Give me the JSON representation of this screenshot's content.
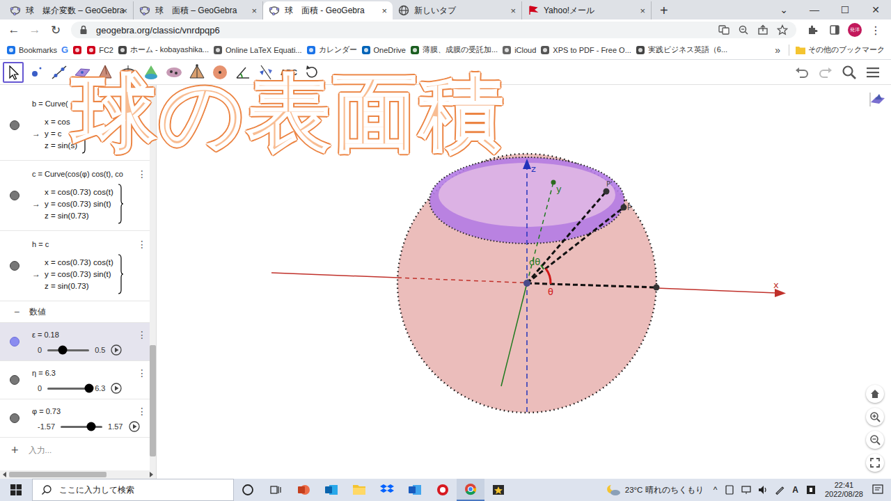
{
  "browser": {
    "tabs": [
      {
        "label": "球　媒介変数 – GeoGebra",
        "favicon": "geogebra",
        "selected": false
      },
      {
        "label": "球　面積 – GeoGebra",
        "favicon": "geogebra",
        "selected": false
      },
      {
        "label": "球　面積 - GeoGebra",
        "favicon": "geogebra",
        "selected": true
      },
      {
        "label": "新しいタブ",
        "favicon": "chrome",
        "selected": false
      },
      {
        "label": "Yahoo!メール",
        "favicon": "yahoo",
        "selected": false
      }
    ],
    "tab_close": "×",
    "new_tab": "+",
    "window_controls": [
      "⌄",
      "—",
      "☐",
      "✕"
    ],
    "nav": [
      "←",
      "→",
      "↻"
    ],
    "url": "geogebra.org/classic/vnrdpqp6",
    "profile": "発洋",
    "menu": "⋮",
    "bookmarks": [
      {
        "label": "Bookmarks",
        "color": "#1a73e8"
      },
      {
        "label": "G",
        "color": "#4285f4"
      },
      {
        "label": "",
        "color": "#d0021b"
      },
      {
        "label": "FC2",
        "color": "#d0021b"
      },
      {
        "label": "ホーム - kobayashika...",
        "color": "#444444"
      },
      {
        "label": "Online LaTeX Equati...",
        "color": "#555555"
      },
      {
        "label": "カレンダー",
        "color": "#1a73e8"
      },
      {
        "label": "OneDrive",
        "color": "#0364b8"
      },
      {
        "label": "薄膜、成膜の受託加...",
        "color": "#1b5e20"
      },
      {
        "label": "iCloud",
        "color": "#666666"
      },
      {
        "label": "XPS to PDF - Free O...",
        "color": "#555555"
      },
      {
        "label": "実践ビジネス英語（6...",
        "color": "#444444"
      }
    ],
    "bookmarks_more": "»",
    "other_bookmarks": "その他のブックマーク"
  },
  "toolbar": {
    "tools": [
      {
        "kind": "move",
        "label": "",
        "selected": true
      },
      {
        "kind": "point",
        "label": "",
        "selected": false
      },
      {
        "kind": "line",
        "label": "",
        "selected": false
      },
      {
        "kind": "plane",
        "label": "",
        "selected": false
      },
      {
        "kind": "pyramid",
        "label": "",
        "selected": false
      },
      {
        "kind": "circle",
        "label": "",
        "selected": false
      },
      {
        "kind": "cone",
        "label": "",
        "selected": false
      },
      {
        "kind": "intersect",
        "label": "",
        "selected": false
      },
      {
        "kind": "tetra",
        "label": "",
        "selected": false
      },
      {
        "kind": "sphere",
        "label": "",
        "selected": false
      },
      {
        "kind": "angle",
        "label": "",
        "selected": false
      },
      {
        "kind": "reflect",
        "label": "",
        "selected": false
      },
      {
        "kind": "text",
        "label": "ABC",
        "selected": false
      },
      {
        "kind": "rotate",
        "label": "",
        "selected": false
      }
    ]
  },
  "overlay_title": "球の表面積",
  "algebra": {
    "arrow": "→",
    "row_menu": "⋮",
    "rows": [
      {
        "kind": "curve",
        "selected": false,
        "definition": "b = Curve(",
        "lines": [
          "x = cos",
          "y = c",
          "z = sin(s)"
        ]
      },
      {
        "kind": "curve",
        "selected": false,
        "definition": "c = Curve(cos(φ) cos(t), co",
        "lines": [
          "x = cos(0.73) cos(t)",
          "y = cos(0.73) sin(t)",
          "z = sin(0.73)"
        ]
      },
      {
        "kind": "curve",
        "selected": false,
        "definition": "h = c",
        "lines": [
          "x = cos(0.73) cos(t)",
          "y = cos(0.73) sin(t)",
          "z = sin(0.73)"
        ]
      }
    ],
    "section": {
      "toggle": "−",
      "label": "数値"
    },
    "sliders": [
      {
        "name": "ε = 0.18",
        "min": "0",
        "max": "0.5",
        "level": 0.36,
        "selected": true
      },
      {
        "name": "η = 6.3",
        "min": "0",
        "max": "6.3",
        "level": 1,
        "selected": false
      },
      {
        "name": "φ = 0.73",
        "min": "-1.57",
        "max": "1.57",
        "level": 0.73,
        "selected": false
      }
    ],
    "input": {
      "plus": "+",
      "placeholder": "入力..."
    }
  },
  "graphics": {
    "labels": {
      "z": "z",
      "y": "y",
      "x": "x",
      "theta": "θ",
      "dtheta": "dθ",
      "p": "P",
      "p_prime": "P'"
    }
  },
  "taskbar": {
    "search": "ここに入力して検索",
    "weather": "23°C  晴れのちくもり",
    "tray_up": "^",
    "ime": "A",
    "time": "22:41",
    "date": "2022/08/28"
  }
}
